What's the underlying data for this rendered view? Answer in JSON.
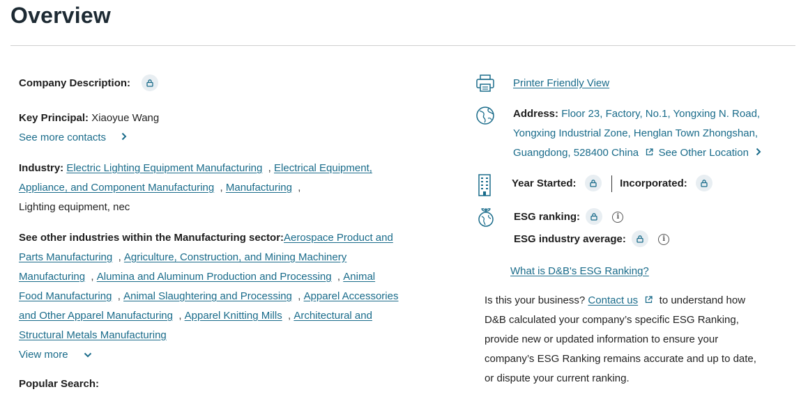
{
  "page": {
    "title": "Overview"
  },
  "left": {
    "company_description_label": "Company Description:",
    "key_principal_label": "Key Principal:",
    "key_principal_value": "Xiaoyue Wang",
    "see_more_contacts": "See more contacts",
    "industry_label": "Industry:",
    "industry_links": [
      "Electric Lighting Equipment Manufacturing",
      "Electrical Equipment, Appliance, and Component Manufacturing",
      "Manufacturing"
    ],
    "industry_plain": "Lighting equipment, nec",
    "other_industries_label": "See other industries within the Manufacturing sector:",
    "other_industries": [
      "Aerospace Product and Parts Manufacturing",
      "Agriculture, Construction, and Mining Machinery Manufacturing",
      "Alumina and Aluminum Production and Processing",
      "Animal Food Manufacturing",
      "Animal Slaughtering and Processing",
      "Apparel Accessories and Other Apparel Manufacturing",
      "Apparel Knitting Mills",
      "Architectural and Structural Metals Manufacturing"
    ],
    "view_more": "View more",
    "popular_search": "Popular Search:"
  },
  "right": {
    "printer_friendly": "Printer Friendly View",
    "address_label": "Address:",
    "address_line1": "Floor 23, Factory, No.1, Yongxing N. Road,",
    "address_line2": "Yongxing Industrial Zone, Henglan Town Zhongshan,",
    "address_line3": "Guangdong, 528400 China",
    "see_other_location": "See Other Location",
    "year_started_label": "Year Started:",
    "incorporated_label": "Incorporated:",
    "esg_ranking_label": "ESG ranking:",
    "esg_industry_avg_label": "ESG industry average:",
    "what_is_esg": "What is D&B's ESG Ranking?",
    "business_q": "Is this your business?",
    "contact_us": "Contact us",
    "business_text1": "to understand how",
    "business_text2": "D&B calculated your company’s specific ESG Ranking,",
    "business_text3": "provide new or updated information to ensure your",
    "business_text4": "company’s ESG Ranking remains accurate and up to date,",
    "business_text5": "or dispute your current ranking."
  },
  "colors": {
    "link": "#196b8a",
    "lock_bg": "#e8eef2",
    "text": "#222222"
  },
  "icons": [
    "lock-icon",
    "printer-icon",
    "globe-icon",
    "building-icon",
    "esg-leaf-icon",
    "info-icon",
    "external-link-icon",
    "chevron-right-icon",
    "chevron-down-icon"
  ]
}
